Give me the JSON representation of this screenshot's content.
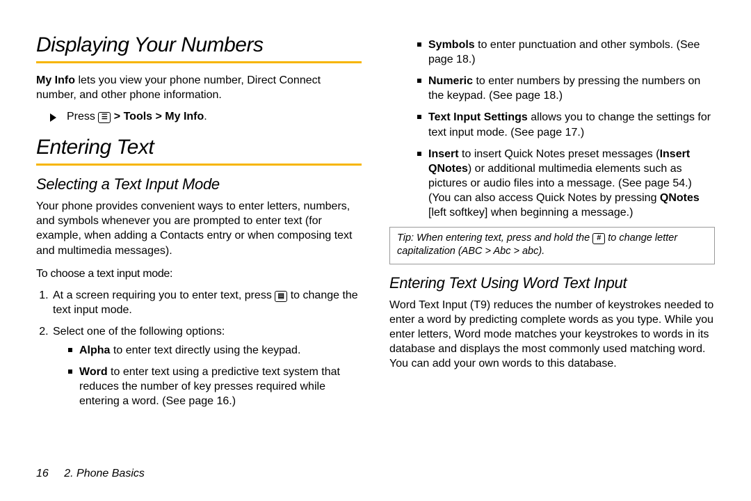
{
  "left": {
    "h1a": "Displaying Your Numbers",
    "para1_pre_bold": "My Info",
    "para1_rest": " lets you view your phone number, Direct Connect number, and other phone information.",
    "press_word": "Press ",
    "press_path_bold": " > Tools > My Info",
    "press_dot": ".",
    "h1b": "Entering Text",
    "h2a": "Selecting a Text Input Mode",
    "para2": "Your phone provides convenient ways to enter letters, numbers, and symbols whenever you are prompted to enter text (for example, when adding a Contacts entry or when composing text and multimedia messages).",
    "instr": "To choose a text input mode:",
    "step1_a": "At a screen requiring you to enter text, press ",
    "step1_b": " to change the text input mode.",
    "step2": "Select one of the following options:",
    "opt_alpha_b": "Alpha",
    "opt_alpha_r": " to enter text directly using the keypad.",
    "opt_word_b": "Word",
    "opt_word_r": " to enter text using a predictive text system that reduces the number of key presses required while entering a word. (See page 16.)"
  },
  "right": {
    "opt_symbols_b": "Symbols",
    "opt_symbols_r": " to enter punctuation and other symbols. (See page 18.)",
    "opt_numeric_b": "Numeric",
    "opt_numeric_r": " to enter numbers by pressing the numbers on the keypad. (See page 18.)",
    "opt_tis_b": "Text Input Settings",
    "opt_tis_r": " allows you to change the settings for text input mode. (See page 17.)",
    "opt_insert_b": "Insert",
    "opt_insert_r1": " to insert Quick Notes preset messages (",
    "opt_insert_b2": "Insert QNotes",
    "opt_insert_r2": ") or additional multimedia elements such as pictures or audio files into a message. (See page 54.) (You can also access Quick Notes by pressing ",
    "opt_insert_b3": "QNotes",
    "opt_insert_r3": " [left softkey] when beginning a message.)",
    "tip_label": "Tip:",
    "tip_a": " When entering text, press and hold the ",
    "tip_b": " to change letter capitalization (ABC > Abc > abc).",
    "h2b": "Entering Text Using Word Text Input",
    "para3": "Word Text Input (T9) reduces the number of keystrokes needed to enter a word by predicting complete words as you type. While you enter letters, Word mode matches your keystrokes to words in its database and displays the most commonly used matching word. You can add your own words to this database."
  },
  "footer": {
    "page_num": "16",
    "chapter": "2. Phone Basics"
  }
}
